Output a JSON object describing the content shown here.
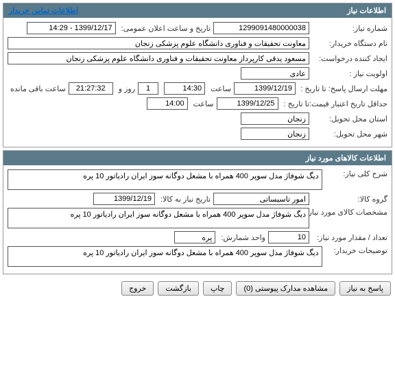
{
  "panel1": {
    "title": "اطلاعات نیاز",
    "contact_link": "اطلاعات تماس خریدار",
    "need_number_label": "شماره نیاز:",
    "need_number": "1299091480000038",
    "announce_label": "تاریخ و ساعت اعلان عمومی:",
    "announce_value": "1399/12/17 - 14:29",
    "org_label": "نام دستگاه خریدار:",
    "org_value": "معاونت تحقیقات و فناوری دانشگاه علوم پزشکی زنجان",
    "creator_label": "ایجاد کننده درخواست:",
    "creator_value": "مسعود یدقی کارپرداز معاونت تحقیقات و فناوری دانشگاه علوم پزشکی زنجان",
    "priority_label": "اولویت نیاز :",
    "priority_value": "عادی",
    "deadline_label": "مهلت ارسال پاسخ:  تا تاریخ :",
    "deadline_date": "1399/12/19",
    "deadline_time_label": "ساعت",
    "deadline_time": "14:30",
    "remain_days": "1",
    "remain_days_label": "روز و",
    "remain_hours": "21:27:32",
    "remain_label": "ساعت باقی مانده",
    "validity_label": "حداقل تاریخ اعتبار قیمت:",
    "validity_until_label": "تا تاریخ :",
    "validity_date": "1399/12/25",
    "validity_time_label": "ساعت",
    "validity_time": "14:00",
    "province_label": "استان محل تحویل:",
    "province_value": "زنجان",
    "city_label": "شهر محل تحویل:",
    "city_value": "زنجان"
  },
  "panel2": {
    "title": "اطلاعات کالاهای مورد نیاز",
    "desc_label": "شرح کلی نیاز:",
    "desc_value": "دیگ شوفاژ مدل سوپر 400 همراه با مشعل دوگانه سوز ایران رادیاتور 10 پره",
    "group_label": "گروه کالا:",
    "group_value": "امور تاسیساتی",
    "need_date_label": "تاریخ نیاز به کالا:",
    "need_date_value": "1399/12/19",
    "spec_label": "مشخصات کالای مورد نیاز:",
    "spec_value": "دیگ شوفاژ مدل سوپر 400 همراه با مشعل دوگانه سوز ایران رادیاتور 10 پره",
    "qty_label": "تعداد / مقدار مورد نیاز:",
    "qty_value": "10",
    "unit_label": "واحد شمارش:",
    "unit_value": "پره",
    "buyer_notes_label": "توضیحات خریدار:",
    "buyer_notes_value": "دیگ شوفاژ مدل سوپر 400 همراه با مشعل دوگانه سوز ایران رادیاتور 10 پره"
  },
  "buttons": {
    "reply": "پاسخ به نیاز",
    "attachments": "مشاهده مدارک پیوستی (0)",
    "print": "چاپ",
    "back": "بازگشت",
    "exit": "خروج"
  }
}
